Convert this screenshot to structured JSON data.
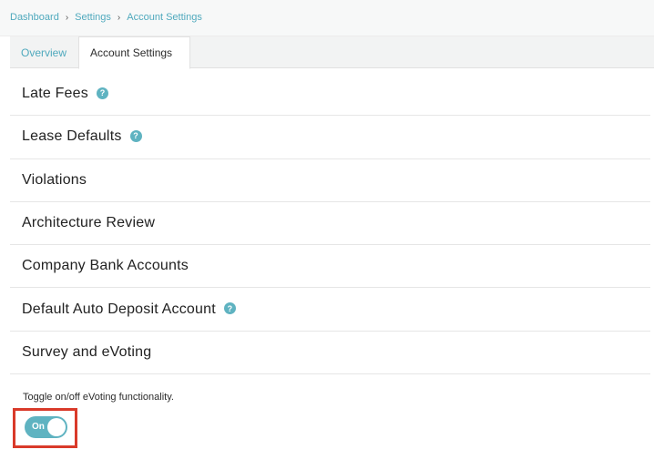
{
  "breadcrumb": [
    "Dashboard",
    "Settings",
    "Account Settings"
  ],
  "breadcrumb_separator": "›",
  "tabs": [
    {
      "label": "Overview"
    },
    {
      "label": "Account Settings"
    }
  ],
  "sections": [
    {
      "label": "Late Fees",
      "help": true
    },
    {
      "label": "Lease Defaults",
      "help": true
    },
    {
      "label": "Violations",
      "help": false
    },
    {
      "label": "Architecture Review",
      "help": false
    },
    {
      "label": "Company Bank Accounts",
      "help": false
    },
    {
      "label": "Default Auto Deposit Account",
      "help": true
    },
    {
      "label": "Survey and eVoting",
      "help": false
    }
  ],
  "help_icon_glyph": "?",
  "evoting": {
    "description": "Toggle on/off eVoting functionality.",
    "toggle_label": "On",
    "toggle_state": "on"
  },
  "colors": {
    "accent": "#5fb3c1",
    "link": "#4fa9bd",
    "highlight_border": "#d93a2a"
  }
}
